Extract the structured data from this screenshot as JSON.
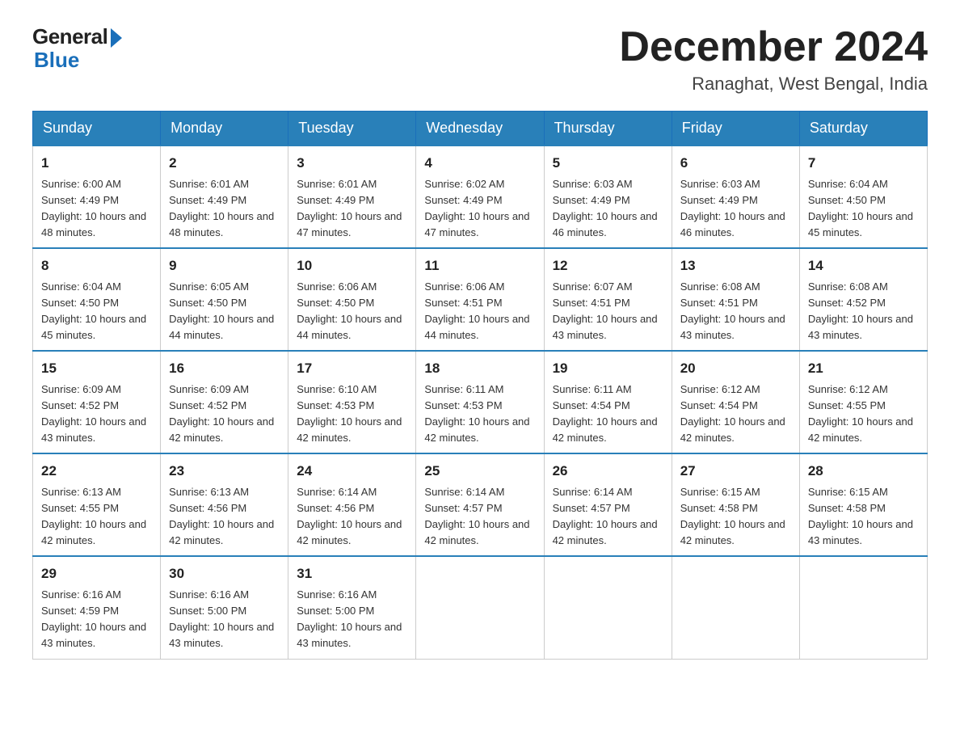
{
  "header": {
    "logo_general": "General",
    "logo_blue": "Blue",
    "month_title": "December 2024",
    "location": "Ranaghat, West Bengal, India"
  },
  "days_of_week": [
    "Sunday",
    "Monday",
    "Tuesday",
    "Wednesday",
    "Thursday",
    "Friday",
    "Saturday"
  ],
  "weeks": [
    [
      {
        "day": "1",
        "sunrise": "6:00 AM",
        "sunset": "4:49 PM",
        "daylight": "10 hours and 48 minutes."
      },
      {
        "day": "2",
        "sunrise": "6:01 AM",
        "sunset": "4:49 PM",
        "daylight": "10 hours and 48 minutes."
      },
      {
        "day": "3",
        "sunrise": "6:01 AM",
        "sunset": "4:49 PM",
        "daylight": "10 hours and 47 minutes."
      },
      {
        "day": "4",
        "sunrise": "6:02 AM",
        "sunset": "4:49 PM",
        "daylight": "10 hours and 47 minutes."
      },
      {
        "day": "5",
        "sunrise": "6:03 AM",
        "sunset": "4:49 PM",
        "daylight": "10 hours and 46 minutes."
      },
      {
        "day": "6",
        "sunrise": "6:03 AM",
        "sunset": "4:49 PM",
        "daylight": "10 hours and 46 minutes."
      },
      {
        "day": "7",
        "sunrise": "6:04 AM",
        "sunset": "4:50 PM",
        "daylight": "10 hours and 45 minutes."
      }
    ],
    [
      {
        "day": "8",
        "sunrise": "6:04 AM",
        "sunset": "4:50 PM",
        "daylight": "10 hours and 45 minutes."
      },
      {
        "day": "9",
        "sunrise": "6:05 AM",
        "sunset": "4:50 PM",
        "daylight": "10 hours and 44 minutes."
      },
      {
        "day": "10",
        "sunrise": "6:06 AM",
        "sunset": "4:50 PM",
        "daylight": "10 hours and 44 minutes."
      },
      {
        "day": "11",
        "sunrise": "6:06 AM",
        "sunset": "4:51 PM",
        "daylight": "10 hours and 44 minutes."
      },
      {
        "day": "12",
        "sunrise": "6:07 AM",
        "sunset": "4:51 PM",
        "daylight": "10 hours and 43 minutes."
      },
      {
        "day": "13",
        "sunrise": "6:08 AM",
        "sunset": "4:51 PM",
        "daylight": "10 hours and 43 minutes."
      },
      {
        "day": "14",
        "sunrise": "6:08 AM",
        "sunset": "4:52 PM",
        "daylight": "10 hours and 43 minutes."
      }
    ],
    [
      {
        "day": "15",
        "sunrise": "6:09 AM",
        "sunset": "4:52 PM",
        "daylight": "10 hours and 43 minutes."
      },
      {
        "day": "16",
        "sunrise": "6:09 AM",
        "sunset": "4:52 PM",
        "daylight": "10 hours and 42 minutes."
      },
      {
        "day": "17",
        "sunrise": "6:10 AM",
        "sunset": "4:53 PM",
        "daylight": "10 hours and 42 minutes."
      },
      {
        "day": "18",
        "sunrise": "6:11 AM",
        "sunset": "4:53 PM",
        "daylight": "10 hours and 42 minutes."
      },
      {
        "day": "19",
        "sunrise": "6:11 AM",
        "sunset": "4:54 PM",
        "daylight": "10 hours and 42 minutes."
      },
      {
        "day": "20",
        "sunrise": "6:12 AM",
        "sunset": "4:54 PM",
        "daylight": "10 hours and 42 minutes."
      },
      {
        "day": "21",
        "sunrise": "6:12 AM",
        "sunset": "4:55 PM",
        "daylight": "10 hours and 42 minutes."
      }
    ],
    [
      {
        "day": "22",
        "sunrise": "6:13 AM",
        "sunset": "4:55 PM",
        "daylight": "10 hours and 42 minutes."
      },
      {
        "day": "23",
        "sunrise": "6:13 AM",
        "sunset": "4:56 PM",
        "daylight": "10 hours and 42 minutes."
      },
      {
        "day": "24",
        "sunrise": "6:14 AM",
        "sunset": "4:56 PM",
        "daylight": "10 hours and 42 minutes."
      },
      {
        "day": "25",
        "sunrise": "6:14 AM",
        "sunset": "4:57 PM",
        "daylight": "10 hours and 42 minutes."
      },
      {
        "day": "26",
        "sunrise": "6:14 AM",
        "sunset": "4:57 PM",
        "daylight": "10 hours and 42 minutes."
      },
      {
        "day": "27",
        "sunrise": "6:15 AM",
        "sunset": "4:58 PM",
        "daylight": "10 hours and 42 minutes."
      },
      {
        "day": "28",
        "sunrise": "6:15 AM",
        "sunset": "4:58 PM",
        "daylight": "10 hours and 43 minutes."
      }
    ],
    [
      {
        "day": "29",
        "sunrise": "6:16 AM",
        "sunset": "4:59 PM",
        "daylight": "10 hours and 43 minutes."
      },
      {
        "day": "30",
        "sunrise": "6:16 AM",
        "sunset": "5:00 PM",
        "daylight": "10 hours and 43 minutes."
      },
      {
        "day": "31",
        "sunrise": "6:16 AM",
        "sunset": "5:00 PM",
        "daylight": "10 hours and 43 minutes."
      },
      null,
      null,
      null,
      null
    ]
  ],
  "labels": {
    "sunrise_prefix": "Sunrise: ",
    "sunset_prefix": "Sunset: ",
    "daylight_prefix": "Daylight: "
  }
}
